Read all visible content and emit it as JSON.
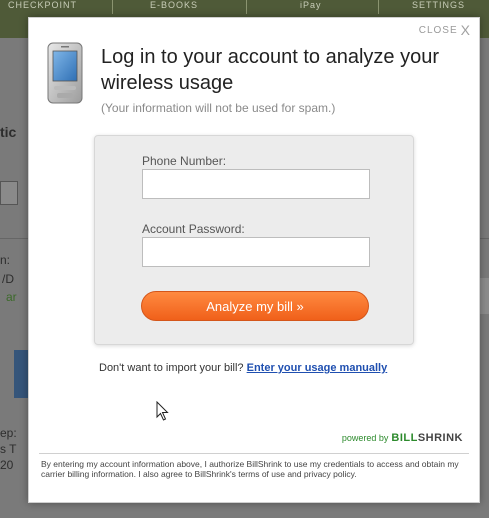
{
  "background": {
    "nav_tabs": [
      "CHECKPOINT",
      "E-BOOKS",
      "iPay",
      "SETTINGS"
    ],
    "fragments": [
      "tic",
      "n:",
      "/D",
      "ar",
      "ep:",
      "s T",
      "20"
    ]
  },
  "modal": {
    "close_label": "CLOSE",
    "close_glyph": "X",
    "title": "Log in to your account to analyze your wireless usage",
    "subtitle": "(Your information will not be used for spam.)",
    "form": {
      "phone_label": "Phone Number:",
      "phone_value": "",
      "password_label": "Account Password:",
      "password_value": "",
      "submit_label": "Analyze my bill »"
    },
    "manual": {
      "prompt": "Don't want to import your bill?",
      "link": "Enter your usage manually"
    },
    "powered_by": "powered by",
    "brand_part1": "BILL",
    "brand_part2": "SHRINK",
    "terms": "By entering my account information above, I authorize BillShrink to use my credentials to access and obtain my carrier billing information. I also agree to BillShrink's terms of use and privacy policy."
  },
  "colors": {
    "accent_orange": "#f0601a",
    "link_blue": "#1f4fb0",
    "brand_green": "#2c8a2c"
  },
  "icons": {
    "phone": "mobile-phone-icon",
    "close": "close-icon",
    "cursor": "mouse-cursor-icon"
  }
}
